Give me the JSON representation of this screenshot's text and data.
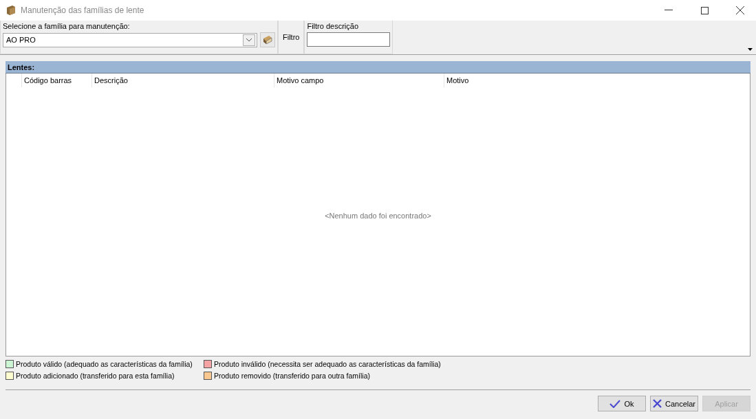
{
  "window": {
    "title": "Manutenção das famílias de lente"
  },
  "family": {
    "label": "Selecione a família para manutenção:",
    "value": "AO PRO"
  },
  "filter": {
    "label": "Filtro",
    "field_label": "Filtro descrição"
  },
  "grid": {
    "title": "Lentes:",
    "columns": [
      "Código barras",
      "Descrição",
      "Motivo campo",
      "Motivo"
    ],
    "empty_message": "<Nenhum dado foi encontrado>"
  },
  "legend": [
    {
      "label": "Produto válido (adequado as características da família)",
      "color": "#ccf5d4"
    },
    {
      "label": "Produto inválido (necessita ser adequado as características da família)",
      "color": "#f5a3a3"
    },
    {
      "label": "Produto adicionado (transferido para esta família)",
      "color": "#fdfdd0"
    },
    {
      "label": "Produto removido (transferido para outra família)",
      "color": "#f8c890"
    }
  ],
  "buttons": [
    {
      "label": "Ok",
      "kind": "ok",
      "disabled": false
    },
    {
      "label": "Cancelar",
      "kind": "cancel",
      "disabled": false
    },
    {
      "label": "Aplicar",
      "kind": "plain",
      "disabled": true
    }
  ]
}
